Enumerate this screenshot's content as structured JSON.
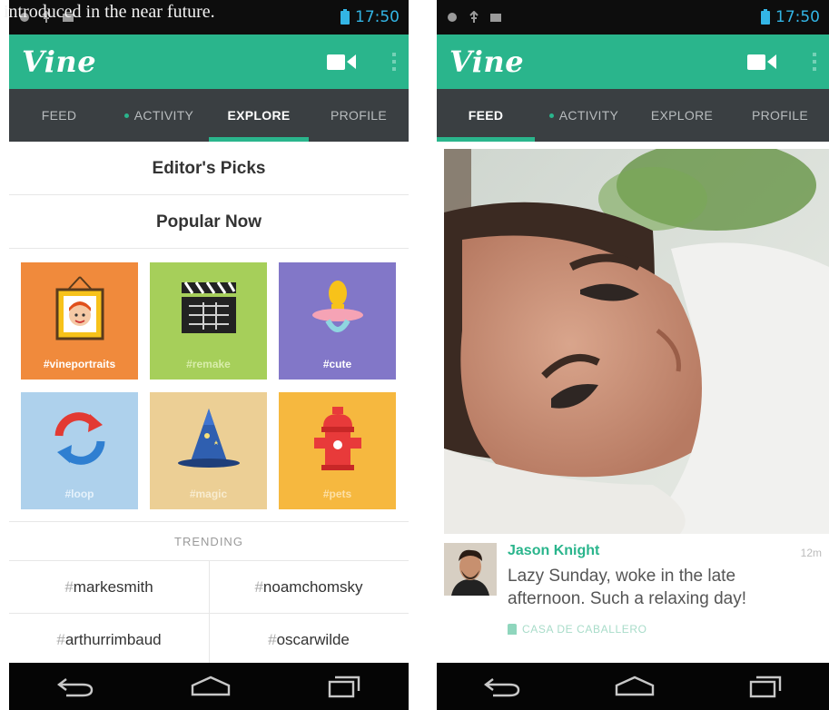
{
  "caption": "introduced in the near future.",
  "status": {
    "time": "17:50"
  },
  "colors": {
    "brand": "#2ab58c",
    "tab_bar": "#3a3f42",
    "status_accent": "#33b5e5"
  },
  "app": {
    "logo": "Vine"
  },
  "tabs": [
    {
      "label": "FEED"
    },
    {
      "label": "ACTIVITY"
    },
    {
      "label": "EXPLORE"
    },
    {
      "label": "PROFILE"
    }
  ],
  "explore": {
    "editors_picks": "Editor's Picks",
    "popular_now": "Popular Now",
    "tiles": [
      {
        "label": "#vineportraits",
        "color": "#f08a3c",
        "icon": "portrait-frame-icon"
      },
      {
        "label": "#remake",
        "color": "#a6cf5a",
        "icon": "clapperboard-icon"
      },
      {
        "label": "#cute",
        "color": "#8277c8",
        "icon": "pacifier-icon"
      },
      {
        "label": "#loop",
        "color": "#aed1ec",
        "icon": "loop-arrows-icon"
      },
      {
        "label": "#magic",
        "color": "#eccf95",
        "icon": "wizard-hat-icon"
      },
      {
        "label": "#pets",
        "color": "#f6b83f",
        "icon": "fire-hydrant-icon"
      }
    ],
    "trending_label": "TRENDING",
    "trending": [
      {
        "hash": "#",
        "tag": "markesmith"
      },
      {
        "hash": "#",
        "tag": "noamchomsky"
      },
      {
        "hash": "#",
        "tag": "arthurrimbaud"
      },
      {
        "hash": "#",
        "tag": "oscarwilde"
      }
    ]
  },
  "feed": {
    "post": {
      "author": "Jason Knight",
      "time": "12m",
      "text": "Lazy Sunday, woke in the late afternoon. Such a relaxing day!",
      "venue": "CASA DE CABALLERO"
    }
  }
}
